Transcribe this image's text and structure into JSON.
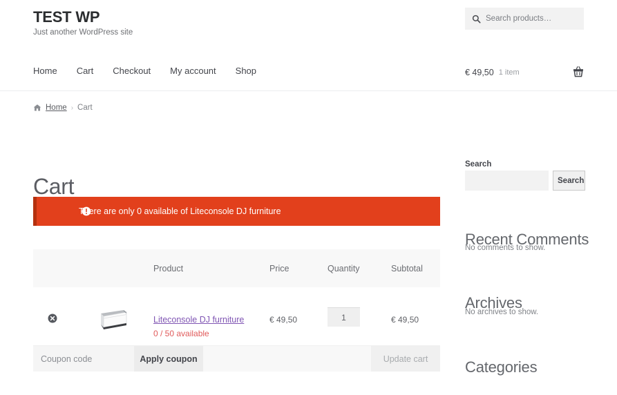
{
  "header": {
    "site_title": "TEST WP",
    "tagline": "Just another WordPress site",
    "nav": [
      {
        "label": "Home"
      },
      {
        "label": "Cart"
      },
      {
        "label": "Checkout"
      },
      {
        "label": "My account"
      },
      {
        "label": "Shop"
      }
    ],
    "product_search": {
      "placeholder": "Search products…",
      "value": "",
      "icon": "search-icon"
    },
    "cart_summary": {
      "amount": "€ 49,50",
      "count": "1 item",
      "icon": "shopping-basket-icon"
    }
  },
  "breadcrumb": {
    "home_icon": "home-icon",
    "home_label": "Home",
    "separator": "›",
    "current": "Cart"
  },
  "main": {
    "page_title": "Cart",
    "notice": {
      "icon": "exclamation-circle-icon",
      "text": "There are only 0 available of Liteconsole DJ furniture",
      "background": "#e2401c",
      "accent": "#b5310f"
    },
    "cart_table": {
      "columns": [
        "Product",
        "Price",
        "Quantity",
        "Subtotal"
      ],
      "rows": [
        {
          "remove_icon": "remove-item-icon",
          "thumbnail": "product-thumbnail-dj-furniture",
          "product": "Liteconsole DJ furniture",
          "stock_note": "0 / 50 available",
          "price": "€ 49,50",
          "quantity": "1",
          "subtotal": "€ 49,50"
        }
      ],
      "actions": {
        "coupon_placeholder": "Coupon code",
        "coupon_value": "",
        "apply_coupon_label": "Apply coupon",
        "update_cart_label": "Update cart"
      }
    }
  },
  "sidebar": {
    "search_widget": {
      "title": "Search",
      "input_value": "",
      "button_label": "Search"
    },
    "widgets": [
      {
        "title": "Recent Comments",
        "empty_text": "No comments to show."
      },
      {
        "title": "Archives",
        "empty_text": "No archives to show."
      },
      {
        "title": "Categories",
        "empty_text": ""
      }
    ]
  },
  "colors": {
    "notice_red": "#e2401c",
    "notice_accent": "#b5310f",
    "product_link_purple": "#7f54b3",
    "stock_warning_red": "#e05a5a",
    "text_primary": "#43454b",
    "text_muted": "#7f8287"
  }
}
